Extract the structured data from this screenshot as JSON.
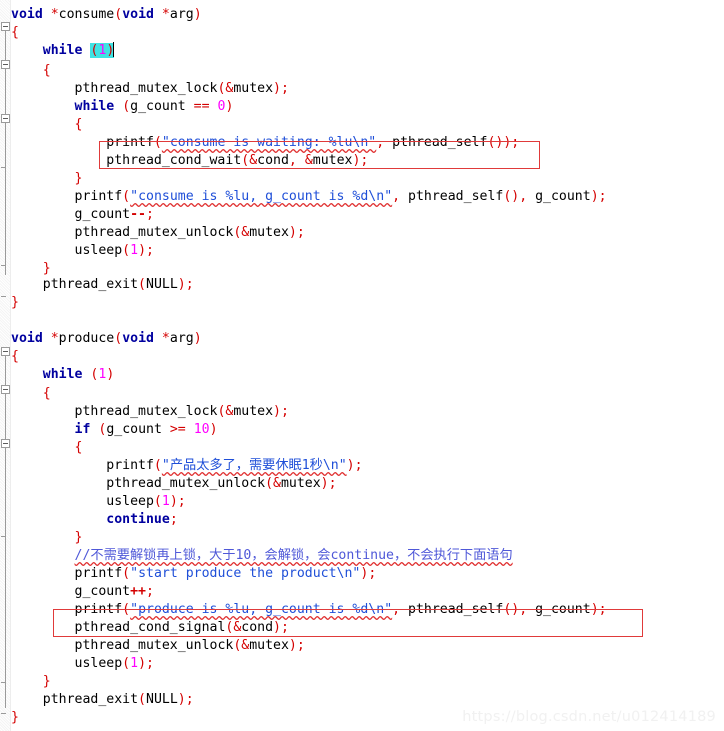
{
  "document": {
    "kind": "source-code-screenshot",
    "language": "C",
    "watermark": "https://blog.csdn.net/u012414189"
  },
  "colors": {
    "background": "#ffffff",
    "keyword": "#00009f",
    "punctuation": "#d40000",
    "number": "#ff00ff",
    "string": "#1f4fd8",
    "comment": "#4f58d8",
    "identifier": "#000000",
    "selection_highlight": "#3fe3e3",
    "annotation_box": "#e03a3a",
    "spellcheck_underline": "#e03030",
    "gutter_marker": "#9a9a9a",
    "watermark": "#f1f1f1"
  },
  "code": {
    "lines": [
      "void *consume(void *arg)",
      "{",
      "    while (1)",
      "    {",
      "        pthread_mutex_lock(&mutex);",
      "        while (g_count == 0)",
      "        {",
      "            printf(\"consume is waiting: %lu\\n\", pthread_self());",
      "            pthread_cond_wait(&cond, &mutex);",
      "        }",
      "        printf(\"consume is %lu, g_count is %d\\n\", pthread_self(), g_count);",
      "        g_count--;",
      "        pthread_mutex_unlock(&mutex);",
      "        usleep(1);",
      "    }",
      "    pthread_exit(NULL);",
      "}",
      "",
      "void *produce(void *arg)",
      "{",
      "    while (1)",
      "    {",
      "        pthread_mutex_lock(&mutex);",
      "        if (g_count >= 10)",
      "        {",
      "            printf(\"产品太多了，需要休眠1秒\\n\");",
      "            pthread_mutex_unlock(&mutex);",
      "            usleep(1);",
      "            continue;",
      "        }",
      "        //不需要解锁再上锁，大于10，会解锁，会continue，不会执行下面语句",
      "        printf(\"start produce the product\\n\");",
      "        g_count++;",
      "        printf(\"produce is %lu, g_count is %d\\n\", pthread_self(), g_count);",
      "        pthread_cond_signal(&cond);",
      "        pthread_mutex_unlock(&mutex);",
      "        usleep(1);",
      "    }",
      "    pthread_exit(NULL);",
      "}"
    ],
    "functions": [
      {
        "name": "consume",
        "signature": "void *consume(void *arg)"
      },
      {
        "name": "produce",
        "signature": "void *produce(void *arg)"
      }
    ],
    "highlighted_token": "(1)",
    "annotations": [
      {
        "label": "pthread_cond_wait(&cond, &mutex);",
        "target": "consume-wait-call"
      },
      {
        "label": "pthread_cond_signal(&cond);",
        "target": "produce-signal-call"
      }
    ]
  },
  "tokens": {
    "kw_void": "void",
    "kw_while": "while",
    "kw_if": "if",
    "kw_continue": "continue",
    "id_consume": "consume",
    "id_produce": "produce",
    "id_arg": "arg",
    "id_mutex": "mutex",
    "id_cond": "cond",
    "id_g_count": "g_count",
    "id_pthread_mutex_lock": "pthread_mutex_lock",
    "id_pthread_mutex_unlock": "pthread_mutex_unlock",
    "id_pthread_cond_wait": "pthread_cond_wait",
    "id_pthread_cond_signal": "pthread_cond_signal",
    "id_pthread_self": "pthread_self",
    "id_pthread_exit": "pthread_exit",
    "id_printf": "printf",
    "id_usleep": "usleep",
    "id_null": "NULL",
    "num_0": "0",
    "num_1": "1",
    "num_10": "10",
    "str_consume_waiting": "\"consume is waiting: %lu\\n\"",
    "str_consume_is": "\"consume is %lu, g_count is %d\\n\"",
    "str_too_many": "\"产品太多了，需要休眠1秒\\n\"",
    "str_start_produce": "\"start produce the product\\n\"",
    "str_produce_is": "\"produce is %lu, g_count is %d\\n\"",
    "comment_cn": "//不需要解锁再上锁，大于10，会解锁，会continue，不会执行下面语句",
    "op_deref": "*",
    "op_amp": "&",
    "op_eq": "==",
    "op_ge": ">=",
    "op_inc": "++",
    "op_dec": "--",
    "semi": ";",
    "comma": ",",
    "lparen": "(",
    "rparen": ")",
    "lbrace": "{",
    "rbrace": "}"
  }
}
